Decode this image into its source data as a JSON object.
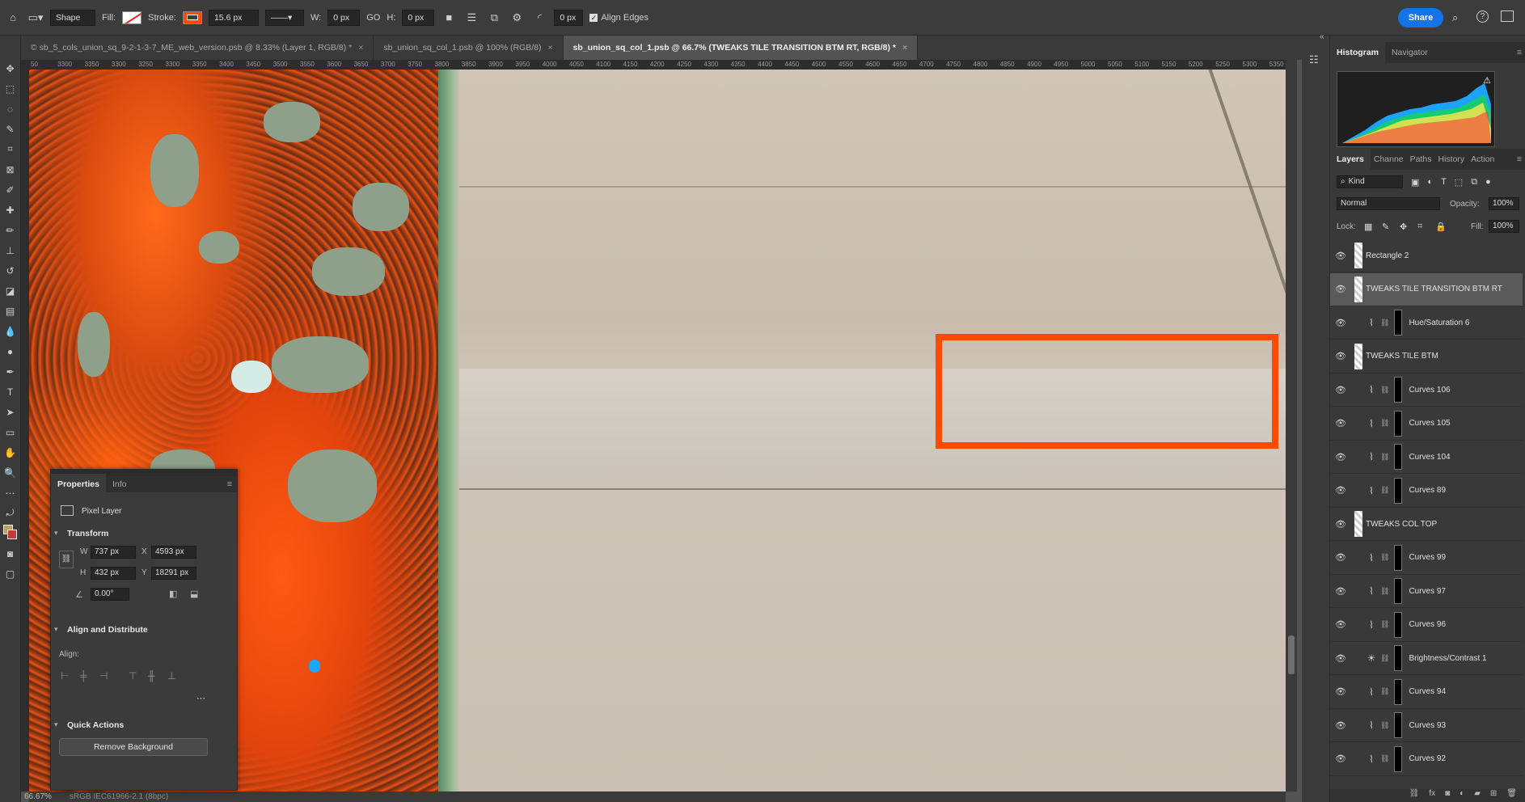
{
  "options_bar": {
    "mode": "Shape",
    "fill_label": "Fill:",
    "stroke_label": "Stroke:",
    "stroke_width": "15.6 px",
    "w_label": "W:",
    "w_value": "0 px",
    "link": "GO",
    "h_label": "H:",
    "h_value": "0 px",
    "radius": "0 px",
    "align_edges": "Align Edges",
    "share": "Share"
  },
  "tabs": [
    {
      "label": "© sb_5_cols_union_sq_9-2-1-3-7_ME_web_version.psb @ 8.33% (Layer 1, RGB/8) *"
    },
    {
      "label": "sb_union_sq_col_1.psb @ 100% (RGB/8)"
    },
    {
      "label": "sb_union_sq_col_1.psb @ 66.7% (TWEAKS TILE TRANSITION BTM RT, RGB/8) *"
    }
  ],
  "ruler_ticks": [
    "50",
    "3300",
    "3350",
    "3300",
    "3250",
    "3300",
    "3350",
    "3400",
    "3450",
    "3500",
    "3550",
    "3600",
    "3650",
    "3700",
    "3750",
    "3800",
    "3850",
    "3900",
    "3950",
    "4000",
    "4050",
    "4100",
    "4150",
    "4200",
    "4250",
    "4300",
    "4350",
    "4400",
    "4450",
    "4500",
    "4550",
    "4600",
    "4650",
    "4700",
    "4750",
    "4800",
    "4850",
    "4900",
    "4950",
    "5000",
    "5050",
    "5100",
    "5150",
    "5200",
    "5250",
    "5300",
    "5350"
  ],
  "status": {
    "zoom": "66.67%",
    "profile": "sRGB IEC61966-2.1 (8bpc)"
  },
  "properties": {
    "tabs": [
      "Properties",
      "Info"
    ],
    "layer_type": "Pixel Layer",
    "transform_title": "Transform",
    "w_label": "W",
    "w": "737 px",
    "x_label": "X",
    "x": "4593 px",
    "h_label": "H",
    "h": "432 px",
    "y_label": "Y",
    "y": "18291 px",
    "angle": "0.00°",
    "align_title": "Align and Distribute",
    "align_label": "Align:",
    "quick_title": "Quick Actions",
    "remove_bg": "Remove Background"
  },
  "top_panel_tabs": [
    "Histogram",
    "Navigator"
  ],
  "layers_tabs": [
    "Layers",
    "Channe",
    "Paths",
    "History",
    "Action"
  ],
  "layers_controls": {
    "kind": "Kind",
    "blend": "Normal",
    "opacity_label": "Opacity:",
    "opacity": "100%",
    "lock_label": "Lock:",
    "fill_label": "Fill:",
    "fill": "100%"
  },
  "layers": [
    {
      "name": "Rectangle 2",
      "kind": "shape",
      "selected": false
    },
    {
      "name": "TWEAKS TILE TRANSITION BTM RT",
      "kind": "pixel",
      "selected": true
    },
    {
      "name": "Hue/Saturation 6",
      "kind": "adj",
      "selected": false
    },
    {
      "name": "TWEAKS TILE BTM",
      "kind": "pixel",
      "selected": false
    },
    {
      "name": "Curves 106",
      "kind": "adj",
      "selected": false
    },
    {
      "name": "Curves 105",
      "kind": "adj",
      "selected": false
    },
    {
      "name": "Curves 104",
      "kind": "adj",
      "selected": false
    },
    {
      "name": "Curves 89",
      "kind": "adj",
      "selected": false
    },
    {
      "name": "TWEAKS COL TOP",
      "kind": "pixel",
      "selected": false
    },
    {
      "name": "Curves 99",
      "kind": "adj",
      "selected": false
    },
    {
      "name": "Curves 97",
      "kind": "adj",
      "selected": false
    },
    {
      "name": "Curves 96",
      "kind": "adj",
      "selected": false
    },
    {
      "name": "Brightness/Contrast 1",
      "kind": "bc",
      "selected": false
    },
    {
      "name": "Curves 94",
      "kind": "adj",
      "selected": false
    },
    {
      "name": "Curves 93",
      "kind": "adj",
      "selected": false
    },
    {
      "name": "Curves 92",
      "kind": "adj",
      "selected": false
    }
  ],
  "colors": {
    "accent": "#1473e6",
    "selection_stroke": "#ff4a00"
  }
}
